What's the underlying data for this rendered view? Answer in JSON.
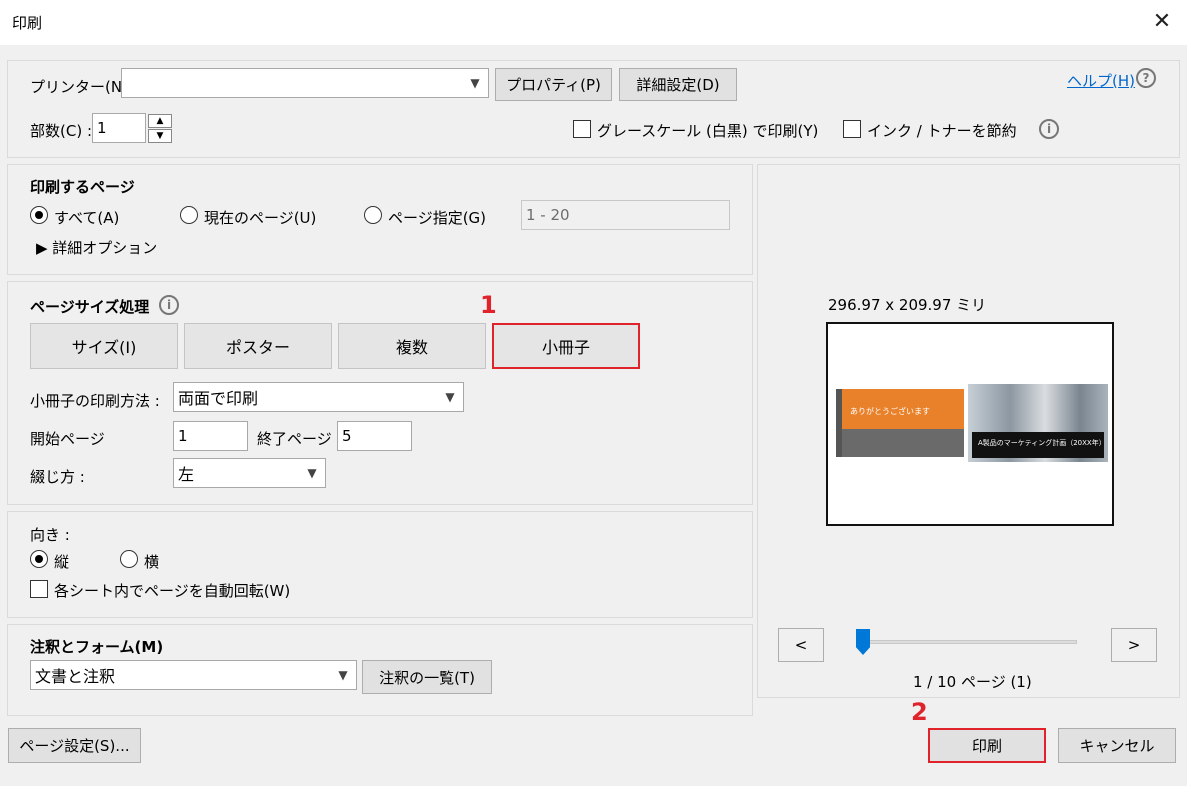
{
  "window": {
    "title": "印刷",
    "close_glyph": "✕"
  },
  "printer": {
    "label": "プリンター(N) :",
    "value": "",
    "properties_button": "プロパティ(P)",
    "advanced_button": "詳細設定(D)"
  },
  "help": {
    "label": "ヘルプ(H)",
    "icon_glyph": "?"
  },
  "copies": {
    "label": "部数(C) :",
    "value": "1",
    "up": "▲",
    "down": "▼"
  },
  "options": {
    "grayscale": "グレースケール (白黒) で印刷(Y)",
    "save_ink": "インク / トナーを節約",
    "info_glyph": "i"
  },
  "pages_to_print": {
    "title": "印刷するページ",
    "all": "すべて(A)",
    "current": "現在のページ(U)",
    "pages": "ページ指定(G)",
    "pages_placeholder": "1 - 20",
    "more_options": "▶ 詳細オプション"
  },
  "page_sizing": {
    "title": "ページサイズ処理",
    "info_glyph": "i",
    "size_button": "サイズ(I)",
    "poster_button": "ポスター",
    "multiple_button": "複数",
    "booklet_button": "小冊子",
    "booklet_subset_label": "小冊子の印刷方法 :",
    "booklet_subset_value": "両面で印刷",
    "start_page_label": "開始ページ",
    "start_page_value": "1",
    "end_page_label": "終了ページ",
    "end_page_value": "5",
    "binding_label": "綴じ方 :",
    "binding_value": "左"
  },
  "orientation": {
    "title": "向き :",
    "portrait": "縦",
    "landscape": "横",
    "auto_rotate": "各シート内でページを自動回転(W)"
  },
  "comments": {
    "title": "注釈とフォーム(M)",
    "value": "文書と注釈",
    "summary_button": "注釈の一覧(T)"
  },
  "preview": {
    "size_text": "296.97 x 209.97 ミリ",
    "slide_left_title": "ありがとうございます",
    "slide_right_title": "A製品のマーケティング計画（20XX年）",
    "prev": "<",
    "next": ">",
    "page_indicator": "1 / 10 ページ (1)",
    "slider_value": 0.0
  },
  "footer": {
    "page_setup": "ページ設定(S)...",
    "print": "印刷",
    "cancel": "キャンセル"
  },
  "annotations": {
    "step1": "1",
    "step2": "2"
  },
  "colors": {
    "highlight": "#e0232b",
    "accent": "#0078d7",
    "orange": "#e8812a"
  }
}
